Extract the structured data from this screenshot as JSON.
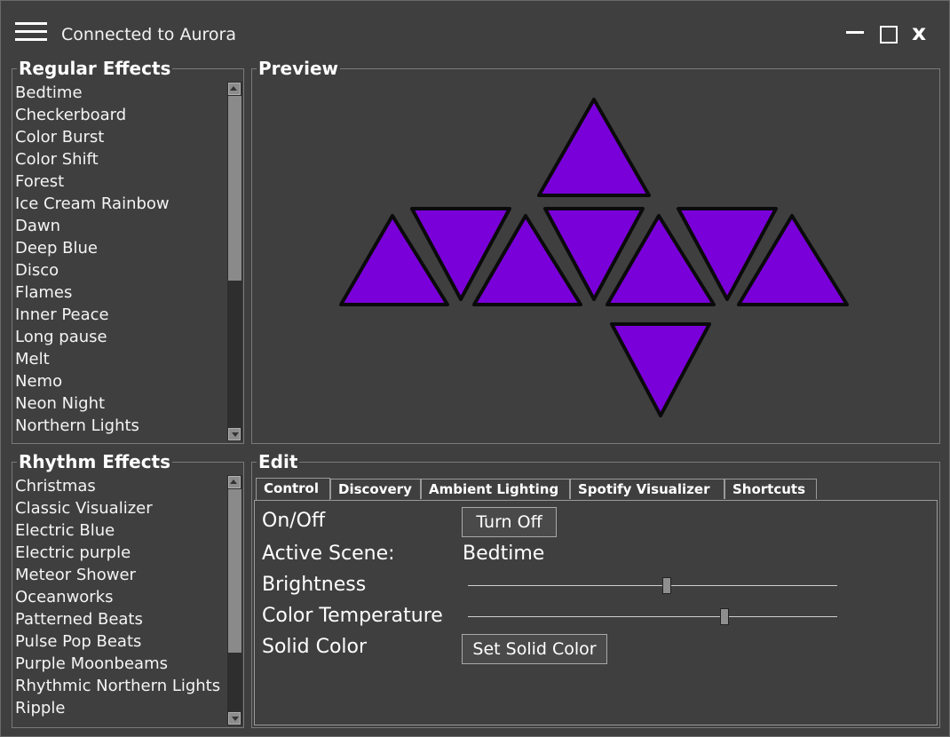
{
  "window": {
    "title": "Connected to Aurora",
    "close_label": "x"
  },
  "regular_effects": {
    "title": "Regular Effects",
    "items": [
      "Bedtime",
      "Checkerboard",
      "Color Burst",
      "Color Shift",
      "Forest",
      "Ice Cream Rainbow",
      "Dawn",
      "Deep Blue",
      "Disco",
      "Flames",
      "Inner Peace",
      "Long pause",
      "Melt",
      "Nemo",
      "Neon Night",
      "Northern Lights"
    ]
  },
  "rhythm_effects": {
    "title": "Rhythm Effects",
    "items": [
      "Christmas",
      "Classic Visualizer",
      "Electric Blue",
      "Electric purple",
      "Meteor Shower",
      "Oceanworks",
      "Patterned Beats",
      "Pulse Pop Beats",
      "Purple Moonbeams",
      "Rhythmic Northern Lights",
      "Ripple"
    ]
  },
  "preview": {
    "title": "Preview",
    "panel_color": "#7a00d9",
    "outline_color": "#0a0a0a",
    "panel_count": 9
  },
  "edit": {
    "title": "Edit",
    "tabs": [
      "Control",
      "Discovery",
      "Ambient Lighting",
      "Spotify Visualizer",
      "Shortcuts"
    ],
    "active_tab": "Control",
    "control": {
      "on_off_label": "On/Off",
      "turn_off_button": "Turn Off",
      "active_scene_label": "Active Scene:",
      "active_scene_value": "Bedtime",
      "brightness_label": "Brightness",
      "brightness_value": 0.54,
      "color_temperature_label": "Color Temperature",
      "color_temperature_value": 0.7,
      "solid_color_label": "Solid Color",
      "set_solid_color_button": "Set Solid Color"
    }
  },
  "colors": {
    "background": "#3f3f3f",
    "border": "#7a7a7a",
    "text": "#ffffff"
  }
}
